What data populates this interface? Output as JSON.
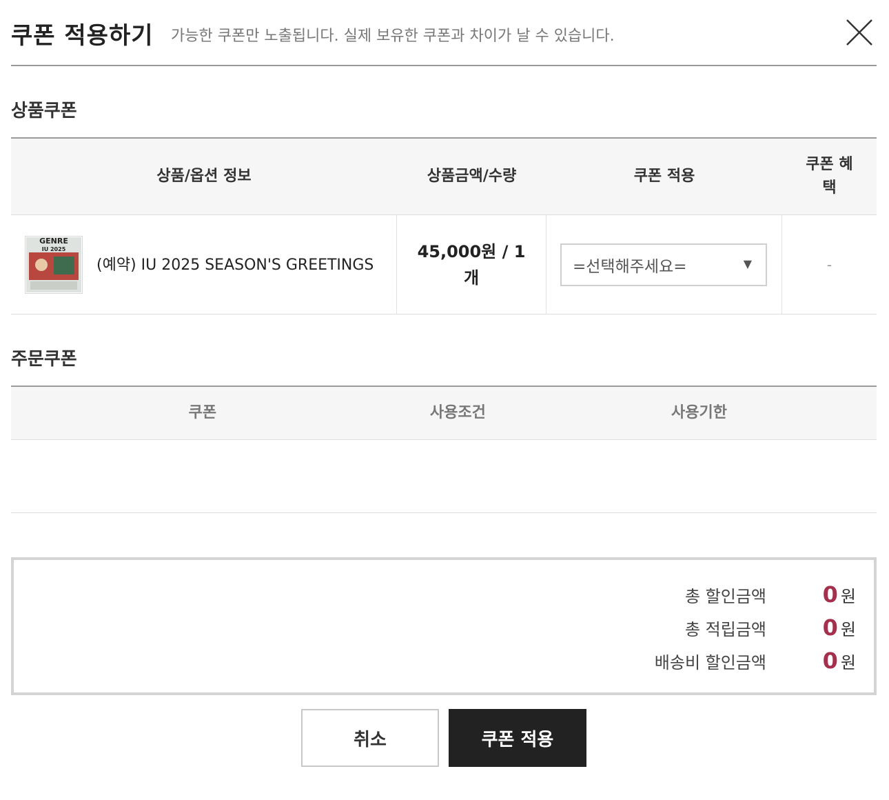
{
  "header": {
    "title": "쿠폰 적용하기",
    "subtitle": "가능한 쿠폰만 노출됩니다. 실제 보유한 쿠폰과 차이가 날 수 있습니다."
  },
  "product_coupon": {
    "section_title": "상품쿠폰",
    "columns": [
      "상품/옵션 정보",
      "상품금액/수량",
      "쿠폰 적용",
      "쿠폰 혜택"
    ],
    "rows": [
      {
        "thumb_text": "GENRE",
        "thumb_year": "IU 2025",
        "name": "(예약) IU 2025 SEASON'S GREETINGS",
        "price_qty": "45,000원 / 1개",
        "select_value": "=선택해주세요=",
        "benefit": "-"
      }
    ]
  },
  "order_coupon": {
    "section_title": "주문쿠폰",
    "columns": [
      "쿠폰",
      "사용조건",
      "사용기한"
    ]
  },
  "summary": {
    "rows": [
      {
        "label": "총 할인금액",
        "amount": "0",
        "unit": "원"
      },
      {
        "label": "총 적립금액",
        "amount": "0",
        "unit": "원"
      },
      {
        "label": "배송비 할인금액",
        "amount": "0",
        "unit": "원"
      }
    ],
    "amount_color": "#a3314e"
  },
  "buttons": {
    "cancel": "취소",
    "apply": "쿠폰 적용"
  }
}
